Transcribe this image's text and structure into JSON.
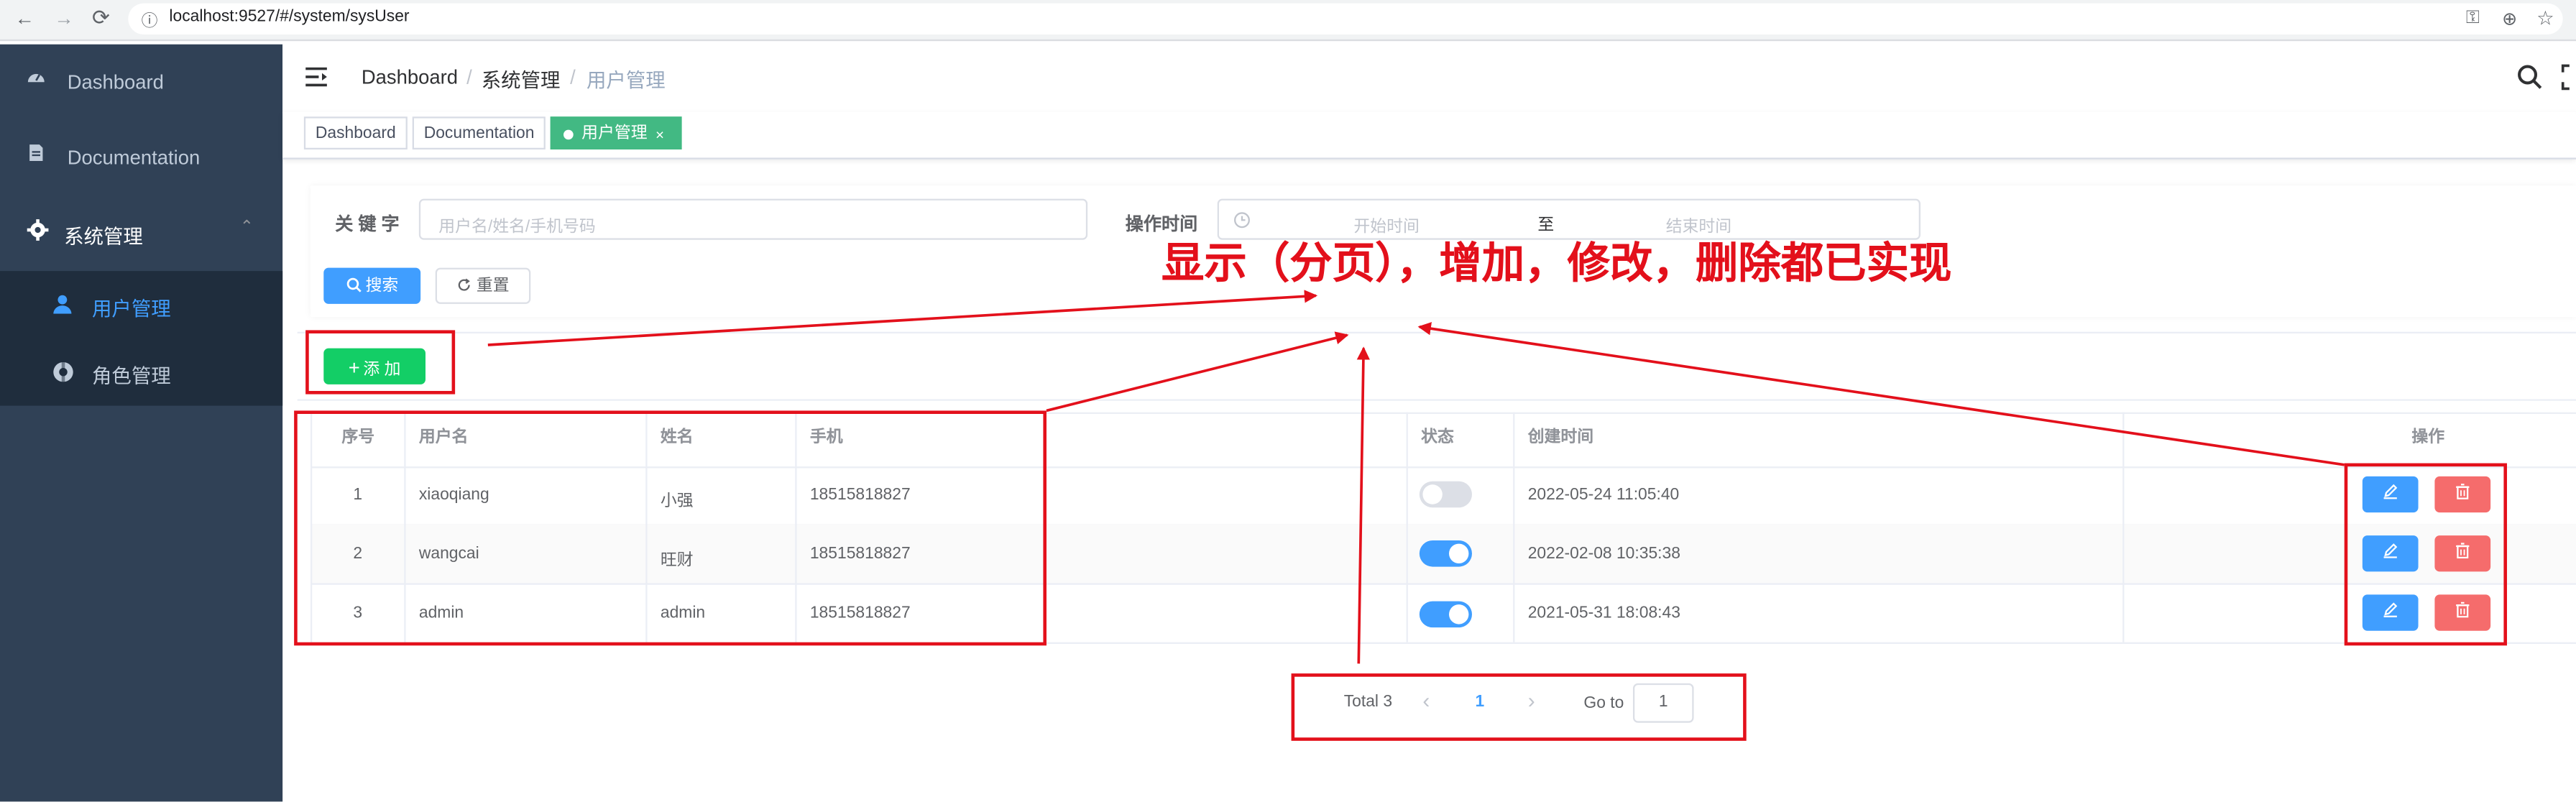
{
  "browser": {
    "url": "localhost:9527/#/system/sysUser",
    "back_icon": "←",
    "forward_icon": "→",
    "reload_icon": "⟳",
    "info_icon": "ⓘ",
    "key_icon": "⚿",
    "zoom_icon": "⊕",
    "star_icon": "☆"
  },
  "sidebar": {
    "items": [
      {
        "label": "Dashboard",
        "icon": "dashboard-icon"
      },
      {
        "label": "Documentation",
        "icon": "documentation-icon"
      },
      {
        "label": "系统管理",
        "icon": "gear-icon",
        "arrow": "⌃"
      }
    ],
    "sub_items": [
      {
        "label": "用户管理",
        "icon": "user-icon",
        "active": true
      },
      {
        "label": "角色管理",
        "icon": "role-icon"
      }
    ]
  },
  "header": {
    "breadcrumb": [
      "Dashboard",
      "系统管理",
      "用户管理"
    ],
    "separator": "/"
  },
  "tags": [
    {
      "label": "Dashboard"
    },
    {
      "label": "Documentation"
    },
    {
      "label": "用户管理",
      "active": true,
      "close": "×"
    }
  ],
  "search": {
    "keyword_label": "关 键 字",
    "keyword_placeholder": "用户名/姓名/手机号码",
    "time_label": "操作时间",
    "start_placeholder": "开始时间",
    "range_separator": "至",
    "end_placeholder": "结束时间",
    "search_button": "搜索",
    "reset_button": "重置"
  },
  "add_button": "添 加",
  "table": {
    "columns": [
      "序号",
      "用户名",
      "姓名",
      "手机",
      "状态",
      "创建时间",
      "操作"
    ],
    "rows": [
      {
        "index": "1",
        "username": "xiaoqiang",
        "name": "小强",
        "phone": "18515818827",
        "status": false,
        "created": "2022-05-24 11:05:40"
      },
      {
        "index": "2",
        "username": "wangcai",
        "name": "旺财",
        "phone": "18515818827",
        "status": true,
        "created": "2022-02-08 10:35:38"
      },
      {
        "index": "3",
        "username": "admin",
        "name": "admin",
        "phone": "18515818827",
        "status": true,
        "created": "2021-05-31 18:08:43"
      }
    ]
  },
  "pagination": {
    "total": "Total 3",
    "prev": "‹",
    "current": "1",
    "next": "›",
    "goto_label": "Go to",
    "goto_value": "1"
  },
  "annotation": {
    "text": "显示（分页），增加，修改，删除都已实现",
    "color": "#e3101b"
  }
}
